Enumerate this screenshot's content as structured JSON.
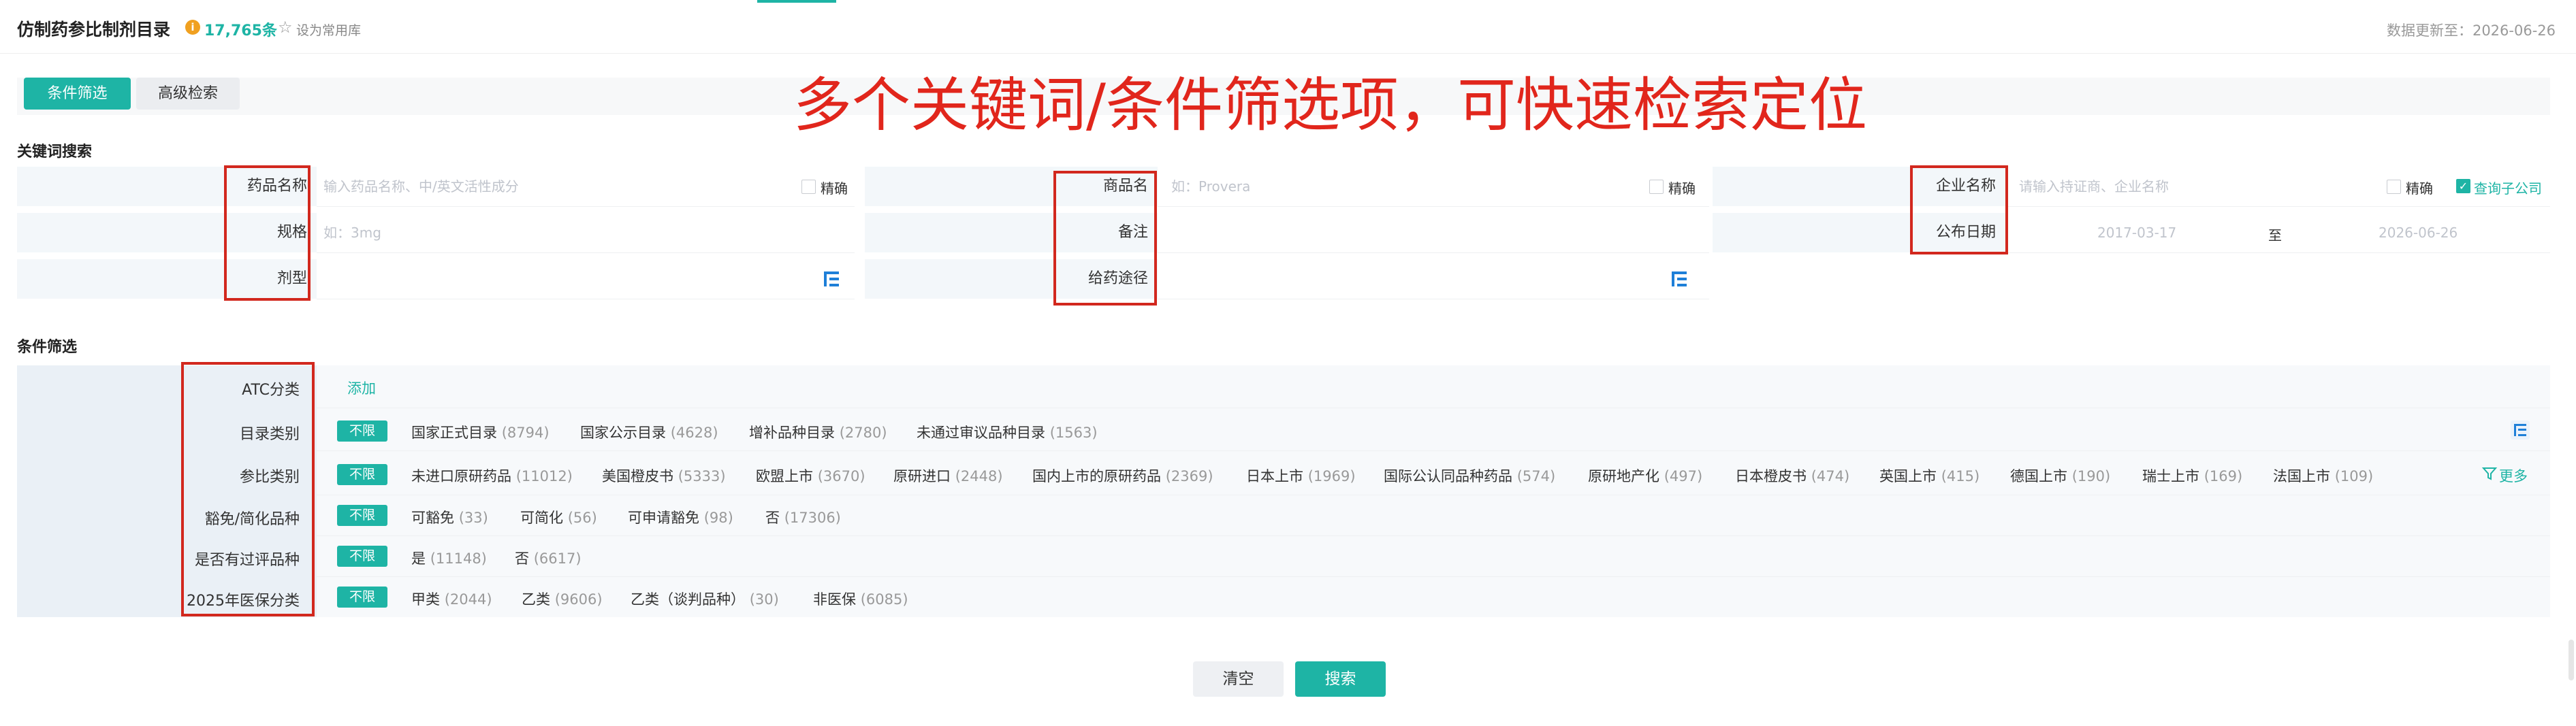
{
  "header": {
    "title": "仿制药参比制剂目录",
    "count": "17,765条",
    "favorite": "设为常用库",
    "update": "数据更新至：2026-06-26"
  },
  "tabs": {
    "filter": "条件筛选",
    "advanced": "高级检索"
  },
  "overlay_text": "多个关键词/条件筛选项，可快速检索定位",
  "keyword": {
    "section_title": "关键词搜索",
    "drug_name": {
      "label": "药品名称",
      "placeholder": "输入药品名称、中/英文活性成分",
      "exact": "精确"
    },
    "spec": {
      "label": "规格",
      "placeholder": "如：3mg"
    },
    "dosage_form": {
      "label": "剂型"
    },
    "trade_name": {
      "label": "商品名",
      "placeholder": "如：Provera",
      "exact": "精确"
    },
    "remark": {
      "label": "备注"
    },
    "route": {
      "label": "给药途径"
    },
    "company": {
      "label": "企业名称",
      "placeholder": "请输入持证商、企业名称",
      "exact": "精确",
      "sub": "查询子公司"
    },
    "publish_date": {
      "label": "公布日期",
      "from": "2017-03-17",
      "to_label": "至",
      "to": "2026-06-26"
    }
  },
  "filter": {
    "section_title": "条件筛选",
    "nolimit": "不限",
    "rows": [
      {
        "label": "ATC分类",
        "add": "添加"
      },
      {
        "label": "目录类别",
        "options": [
          {
            "t": "国家正式目录",
            "n": "(8794)"
          },
          {
            "t": "国家公示目录",
            "n": "(4628)"
          },
          {
            "t": "增补品种目录",
            "n": "(2780)"
          },
          {
            "t": "未通过审议品种目录",
            "n": "(1563)"
          }
        ]
      },
      {
        "label": "参比类别",
        "more": "更多",
        "options": [
          {
            "t": "未进口原研药品",
            "n": "(11012)"
          },
          {
            "t": "美国橙皮书",
            "n": "(5333)"
          },
          {
            "t": "欧盟上市",
            "n": "(3670)"
          },
          {
            "t": "原研进口",
            "n": "(2448)"
          },
          {
            "t": "国内上市的原研药品",
            "n": "(2369)"
          },
          {
            "t": "日本上市",
            "n": "(1969)"
          },
          {
            "t": "国际公认同品种药品",
            "n": "(574)"
          },
          {
            "t": "原研地产化",
            "n": "(497)"
          },
          {
            "t": "日本橙皮书",
            "n": "(474)"
          },
          {
            "t": "英国上市",
            "n": "(415)"
          },
          {
            "t": "德国上市",
            "n": "(190)"
          },
          {
            "t": "瑞士上市",
            "n": "(169)"
          },
          {
            "t": "法国上市",
            "n": "(109)"
          }
        ]
      },
      {
        "label": "豁免/简化品种",
        "options": [
          {
            "t": "可豁免",
            "n": "(33)"
          },
          {
            "t": "可简化",
            "n": "(56)"
          },
          {
            "t": "可申请豁免",
            "n": "(98)"
          },
          {
            "t": "否",
            "n": "(17306)"
          }
        ]
      },
      {
        "label": "是否有过评品种",
        "options": [
          {
            "t": "是",
            "n": "(11148)"
          },
          {
            "t": "否",
            "n": "(6617)"
          }
        ]
      },
      {
        "label": "2025年医保分类",
        "options": [
          {
            "t": "甲类",
            "n": "(2044)"
          },
          {
            "t": "乙类",
            "n": "(9606)"
          },
          {
            "t": "乙类（谈判品种）",
            "n": "(30)"
          },
          {
            "t": "非医保",
            "n": "(6085)"
          }
        ]
      }
    ]
  },
  "buttons": {
    "clear": "清空",
    "search": "搜索"
  },
  "colors": {
    "accent": "#1eb4a5",
    "annotation": "#d2281e",
    "info": "#f0a020"
  }
}
